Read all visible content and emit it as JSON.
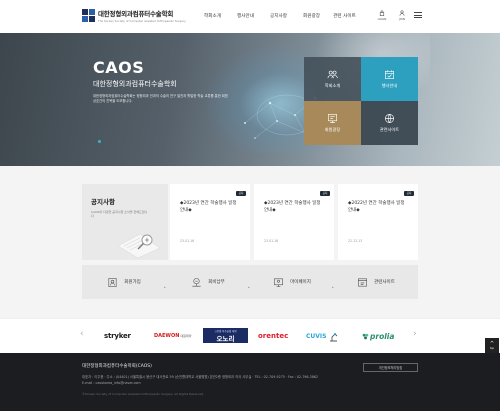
{
  "header": {
    "logo_title": "대한정형외과컴퓨터수술학회",
    "logo_sub": "The Korean Society of Computer Assisted Orthopaedic Surgery",
    "gnb": [
      "학회소개",
      "행사안내",
      "공지사항",
      "회원광장",
      "관련 사이트"
    ],
    "util": {
      "login": "LOGIN",
      "join": "JOIN"
    }
  },
  "hero": {
    "title": "CAOS",
    "subtitle": "대한정형외과컴퓨터수술학회",
    "desc": "대한정형외과컴퓨터수술학회는 정형외과 전과의 수술의 연구 발전과 활발한 학술 교류를 통한 회원 상호간의 친목을 도모합니다."
  },
  "quick": [
    {
      "label": "학회소개",
      "icon": "people-icon"
    },
    {
      "label": "행사안내",
      "icon": "calendar-check-icon"
    },
    {
      "label": "회원광장",
      "icon": "board-icon"
    },
    {
      "label": "관련사이트",
      "icon": "globe-icon"
    }
  ],
  "notice": {
    "title": "공지사항",
    "desc": "CAOS의 다양한 공지사항 소식을 전해드립니다",
    "cards": [
      {
        "badge": "공지",
        "text": "◆2023년 연간 학술행사 일정 안내◆",
        "date": "23.01.16"
      },
      {
        "badge": "공지",
        "text": "◆2023년 연간 학술행사 일정 안내◆",
        "date": "23.01.16"
      },
      {
        "badge": "공지",
        "text": "◆2022년 연간 학술행사 일정 안내◆",
        "date": "22.12.13"
      }
    ]
  },
  "menu": [
    "회원가입",
    "회비납부",
    "마이페이지",
    "관련사이트"
  ],
  "sponsors": {
    "stryker": "stryker",
    "daewon": "DAEWON",
    "daewon_sub": "대원제약",
    "osteo_top": "고관절·척추골절 예방",
    "osteo": "오노리",
    "rentec": "orentec",
    "cuvis": "CUVIS",
    "prolia": "prolia"
  },
  "footer": {
    "title": "대한정형외과컴퓨터수술학회(CAOS)",
    "line1": "대표자 : 이주용   ·   주소 : (04401) 서울특별시 용산구 대사관로 59 (순천향대학교 서울병원) 본관2층 정형외과 의국 사무실   ·   TEL : 02-709-9275   ·   Fax : 02-796-3862",
    "line2": "E-mail : caoskorea_info@naver.com",
    "copy": "©Korean Society of Computer Assisted Orthopaedic Surgery. All Rights Reserved.",
    "button": "개인정보처리방침",
    "top": "top"
  },
  "colors": {
    "accent": "#2da0bf",
    "brown": "#a88a5a",
    "footer_bg": "#1c1d20"
  }
}
